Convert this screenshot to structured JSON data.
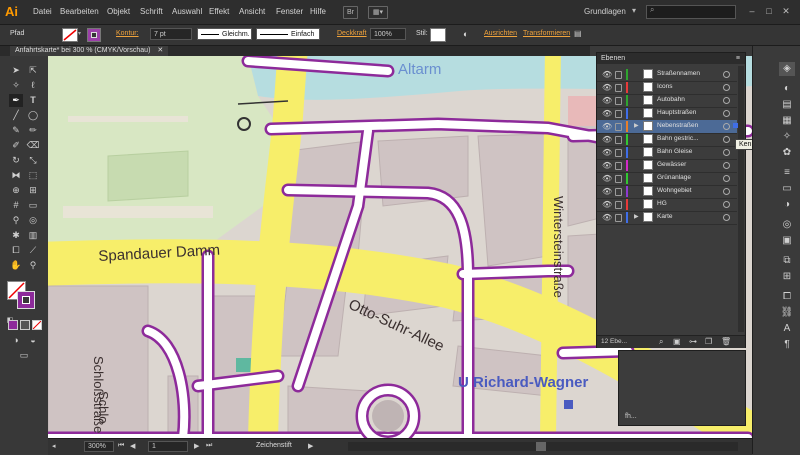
{
  "app": {
    "logo": "Ai"
  },
  "menu": {
    "items": [
      "Datei",
      "Bearbeiten",
      "Objekt",
      "Schrift",
      "Auswahl",
      "Effekt",
      "Ansicht",
      "Fenster",
      "Hilfe"
    ],
    "br_label": "Br",
    "workspace": "Grundlagen"
  },
  "control": {
    "mode": "Pfad",
    "stroke_label": "Kontur:",
    "stroke_weight": "7 pt",
    "profile": "Gleichm.",
    "brush": "Einfach",
    "opacity_label": "Deckkraft",
    "opacity_value": "100%",
    "style_label": "Stil:",
    "align_label": "Ausrichten",
    "transform_label": "Transformieren"
  },
  "document": {
    "tab_title": "Anfahrtskarte* bei 300 % (CMYK/Vorschau)"
  },
  "map": {
    "labels": {
      "altarm": "Altarm",
      "spandauer": "Spandauer Damm",
      "otto": "Otto-Suhr-Allee",
      "schlossstrasse": "Schloßstraße",
      "schlo": "Schlo",
      "winter": "Wintersteinstraße",
      "richard": "U Richard-Wagner"
    },
    "colors": {
      "main_road": "#f7ee6a",
      "side_road": "#ffffff",
      "road_outline": "#8d2a9a",
      "water": "#b6dde0",
      "park": "#d8e7c3",
      "buildings": "#d6cbcb",
      "label_blue": "#4a5bc0"
    }
  },
  "layers": {
    "title": "Ebenen",
    "items": [
      {
        "name": "Straßennamen",
        "color": "#2fa52f"
      },
      {
        "name": "Icons",
        "color": "#e83a3a"
      },
      {
        "name": "Autobahn",
        "color": "#2fa52f"
      },
      {
        "name": "Hauptstraßen",
        "color": "#3f6ee8"
      },
      {
        "name": "Nebenstraßen",
        "color": "#e87f2a"
      },
      {
        "name": "Bahn gestric...",
        "color": "#32c832"
      },
      {
        "name": "Bahn Gleise",
        "color": "#3f6ee8"
      },
      {
        "name": "Gewässer",
        "color": "#d22ac8"
      },
      {
        "name": "Grünanlage",
        "color": "#32c832"
      },
      {
        "name": "Wohngebiet",
        "color": "#8e3ad2"
      },
      {
        "name": "HG",
        "color": "#e83a3a"
      },
      {
        "name": "Karte",
        "color": "#3f6ee8"
      }
    ],
    "count": "12 Ebe...",
    "tooltip": "Kennzeichnet aus"
  },
  "status": {
    "zoom": "300%",
    "page": "1",
    "tool": "Zeichenstift"
  },
  "right_panel_label": "fh..."
}
